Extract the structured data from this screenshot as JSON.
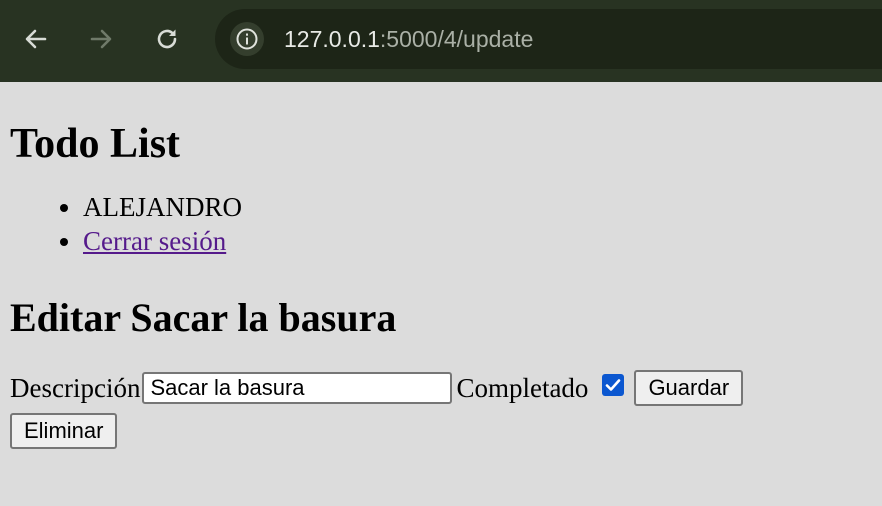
{
  "browser": {
    "url_host": "127.0.0.1",
    "url_rest": ":5000/4/update"
  },
  "page": {
    "title": "Todo List",
    "nav": {
      "user": "ALEJANDRO",
      "logout": "Cerrar sesión"
    },
    "heading": "Editar Sacar la basura",
    "form": {
      "description_label": "Descripción",
      "description_value": "Sacar la basura",
      "completed_label": "Completado",
      "completed": true,
      "save_label": "Guardar",
      "delete_label": "Eliminar"
    }
  }
}
